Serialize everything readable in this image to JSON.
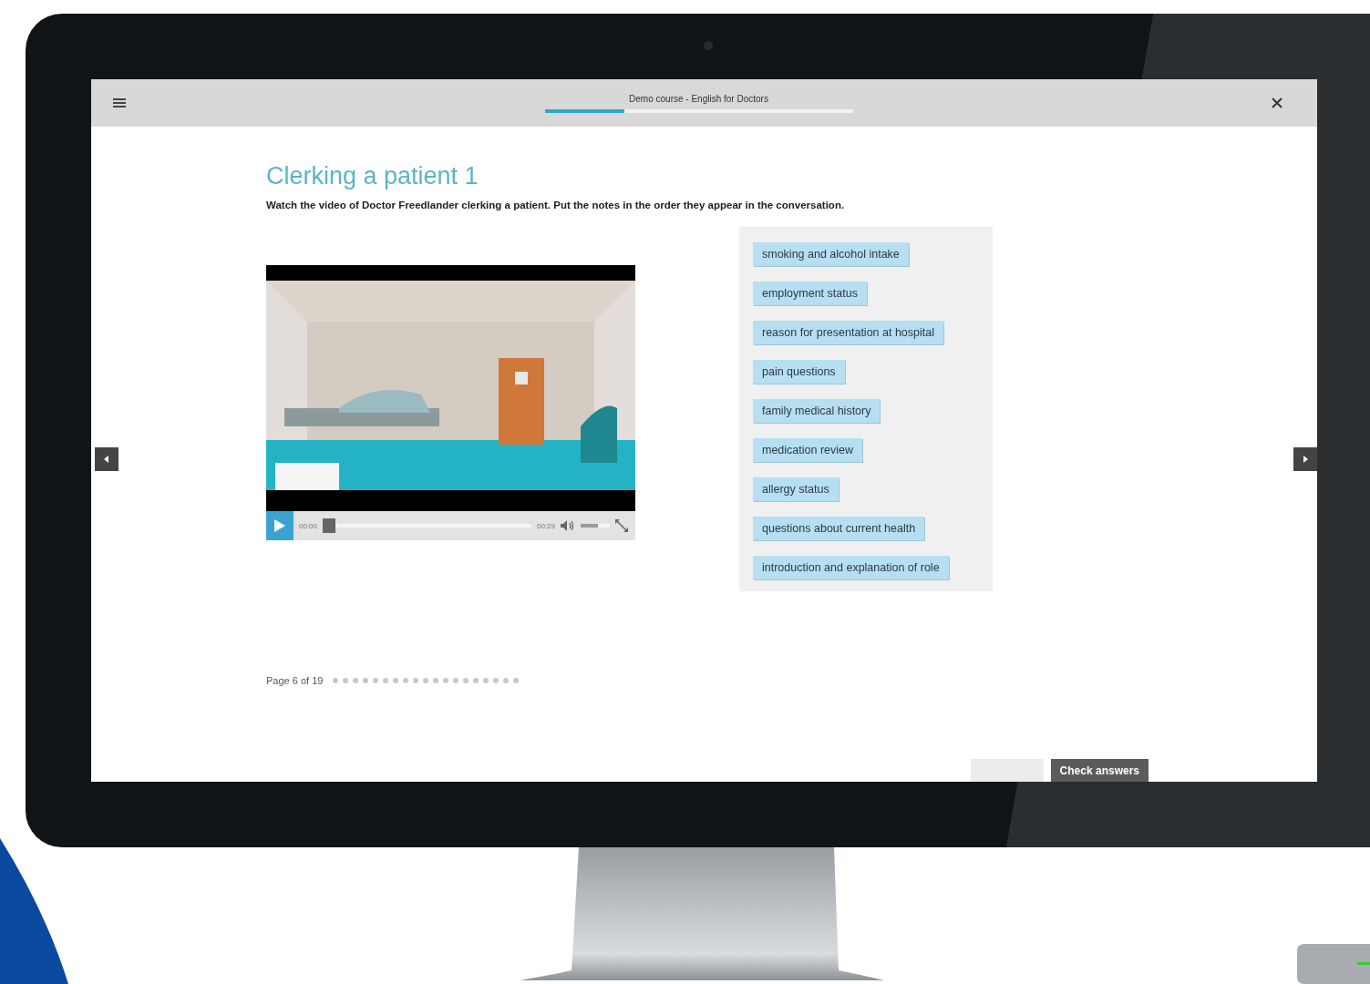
{
  "app_bar": {
    "title": "Demo course - English for Doctors",
    "progress": {
      "level": 0.26
    }
  },
  "heading": "Clerking a patient 1",
  "instructions": "Watch the video of Doctor Freedlander clerking a patient. Put the notes in the order they appear in the conversation.",
  "video": {
    "kind": "picture",
    "current_time": "00:00",
    "duration": "00:29",
    "seek": {
      "level": 0.0
    },
    "volume": {
      "level": 0.6
    }
  },
  "notes": [
    "smoking and alcohol intake",
    "employment status",
    "reason for presentation at hospital",
    "pain questions",
    "family medical history",
    "medication review",
    "allergy status",
    "questions about current health",
    "introduction and explanation of role"
  ],
  "pagination": {
    "label": "Page 6 of 19",
    "dots": [
      {
        "selected": false
      },
      {
        "selected": false
      },
      {
        "selected": false
      },
      {
        "selected": false
      },
      {
        "selected": false
      },
      {
        "selected": false
      },
      {
        "selected": false
      },
      {
        "selected": false
      },
      {
        "selected": false
      },
      {
        "selected": false
      },
      {
        "selected": false
      },
      {
        "selected": false
      },
      {
        "selected": false
      },
      {
        "selected": false
      },
      {
        "selected": false
      },
      {
        "selected": false
      },
      {
        "selected": false
      },
      {
        "selected": false
      },
      {
        "selected": false
      }
    ]
  },
  "buttons": [
    {
      "disabled": true
    },
    {
      "label": "Check answers",
      "disabled": false
    }
  ]
}
